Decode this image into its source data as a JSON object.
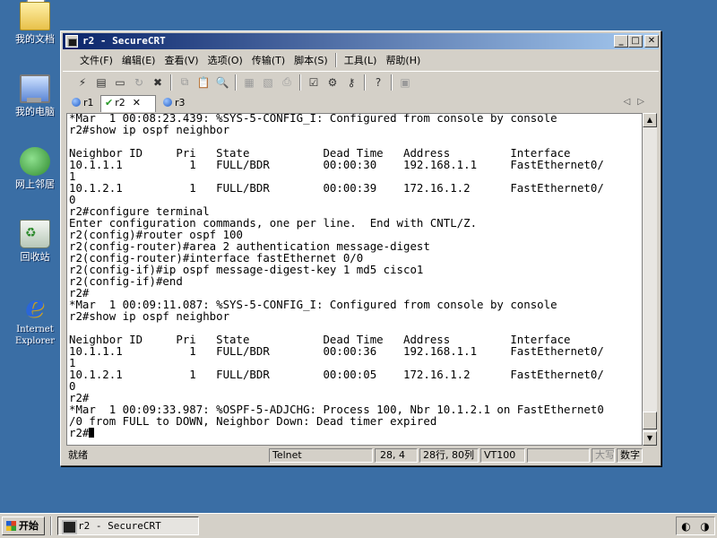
{
  "desktop": {
    "icons": [
      {
        "label": "我的文档",
        "icon": "my-documents-icon"
      },
      {
        "label": "我的电脑",
        "icon": "my-computer-icon"
      },
      {
        "label": "网上邻居",
        "icon": "network-places-icon"
      },
      {
        "label": "回收站",
        "icon": "recycle-bin-icon"
      },
      {
        "label": "Internet Explorer",
        "icon": "internet-explorer-icon"
      }
    ]
  },
  "window": {
    "title": "r2 - SecureCRT",
    "controls": {
      "minimize": "_",
      "maximize": "□",
      "close": "✕"
    }
  },
  "menu": [
    "文件(F)",
    "编辑(E)",
    "查看(V)",
    "选项(O)",
    "传输(T)",
    "脚本(S)",
    "工具(L)",
    "帮助(H)"
  ],
  "tabs": [
    {
      "label": "r1",
      "state": "connected"
    },
    {
      "label": "r2",
      "state": "active",
      "close": "✕"
    },
    {
      "label": "r3",
      "state": "connected"
    }
  ],
  "terminal": {
    "lines": [
      "*Mar  1 00:08:23.439: %SYS-5-CONFIG_I: Configured from console by console",
      "r2#show ip ospf neighbor",
      "",
      "Neighbor ID     Pri   State           Dead Time   Address         Interface",
      "10.1.1.1          1   FULL/BDR        00:00:30    192.168.1.1     FastEthernet0/",
      "1",
      "10.1.2.1          1   FULL/BDR        00:00:39    172.16.1.2      FastEthernet0/",
      "0",
      "r2#configure terminal",
      "Enter configuration commands, one per line.  End with CNTL/Z.",
      "r2(config)#router ospf 100",
      "r2(config-router)#area 2 authentication message-digest",
      "r2(config-router)#interface fastEthernet 0/0",
      "r2(config-if)#ip ospf message-digest-key 1 md5 cisco1",
      "r2(config-if)#end",
      "r2#",
      "*Mar  1 00:09:11.087: %SYS-5-CONFIG_I: Configured from console by console",
      "r2#show ip ospf neighbor",
      "",
      "Neighbor ID     Pri   State           Dead Time   Address         Interface",
      "10.1.1.1          1   FULL/BDR        00:00:36    192.168.1.1     FastEthernet0/",
      "1",
      "10.1.2.1          1   FULL/BDR        00:00:05    172.16.1.2      FastEthernet0/",
      "0",
      "r2#",
      "*Mar  1 00:09:33.987: %OSPF-5-ADJCHG: Process 100, Nbr 10.1.2.1 on FastEthernet0",
      "/0 from FULL to DOWN, Neighbor Down: Dead timer expired"
    ],
    "prompt": "r2#"
  },
  "status": {
    "ready": "就绪",
    "protocol": "Telnet",
    "cursor_pos": "28,  4",
    "size": "28行, 80列",
    "emulation": "VT100",
    "caps": "大写",
    "num": "数字"
  },
  "taskbar": {
    "start": "开始",
    "task": "r2 - SecureCRT"
  }
}
